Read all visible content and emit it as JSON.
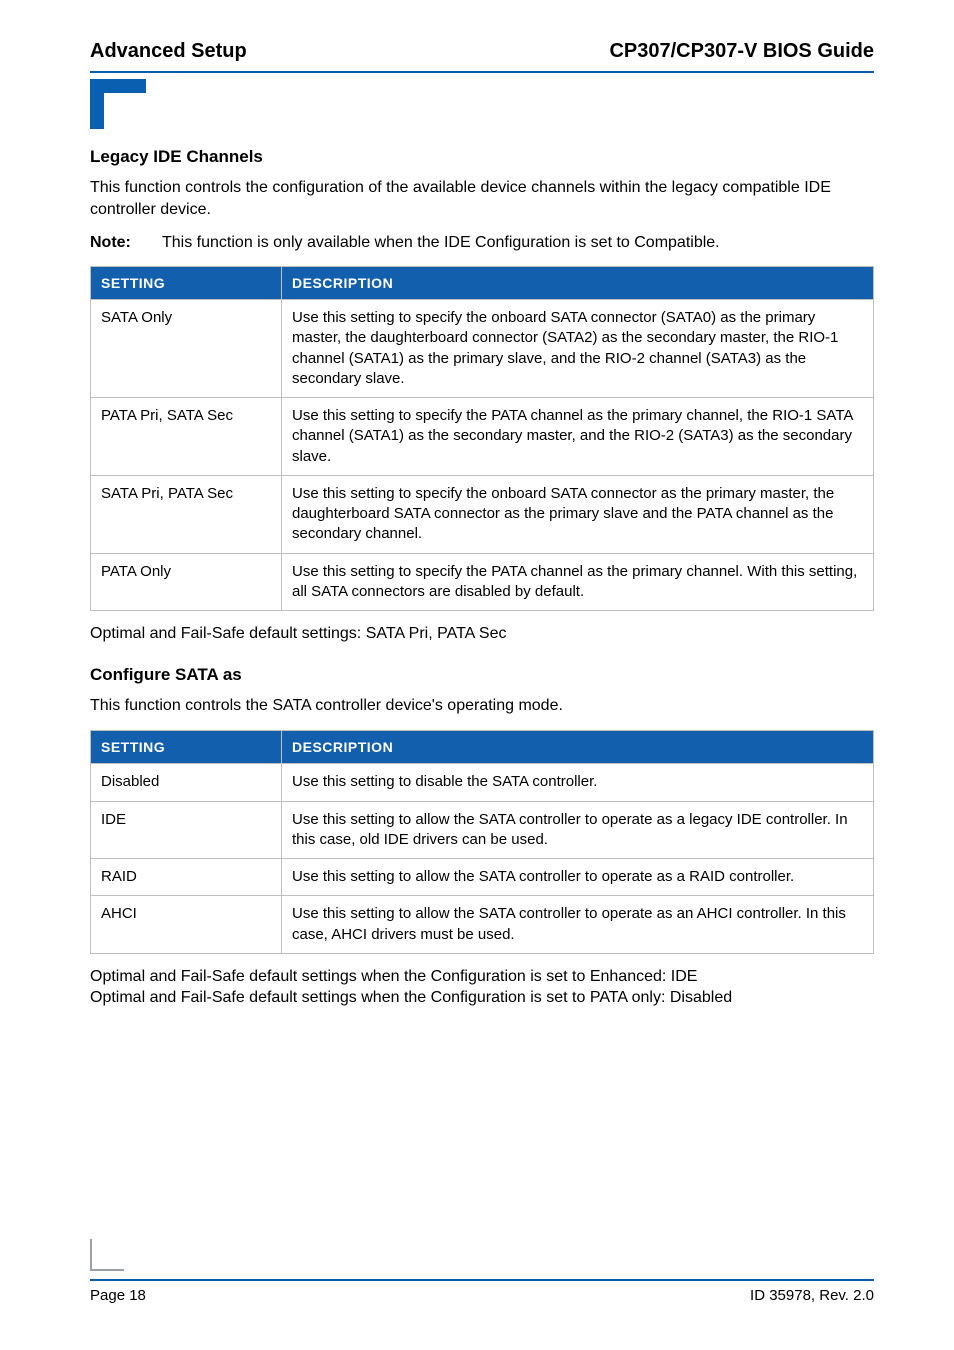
{
  "header": {
    "left": "Advanced Setup",
    "right": "CP307/CP307-V BIOS Guide"
  },
  "section1": {
    "title": "Legacy IDE Channels",
    "intro": "This function controls the configuration of the available device channels within the legacy compatible IDE controller device.",
    "note_label": "Note:",
    "note_text": "This function is only available when the IDE Configuration is set to Compatible.",
    "col_setting": "SETTING",
    "col_desc": "DESCRIPTION",
    "rows": [
      {
        "setting": "SATA Only",
        "desc": "Use this setting to specify the onboard SATA connector (SATA0) as the primary master, the daughterboard connector (SATA2) as the secondary master, the RIO-1 channel (SATA1) as the primary slave, and the RIO-2 channel (SATA3) as the secondary slave."
      },
      {
        "setting": "PATA Pri, SATA Sec",
        "desc": "Use this setting to specify the PATA channel as the primary channel, the RIO-1 SATA channel (SATA1) as the secondary master, and the RIO-2 (SATA3) as the secondary slave."
      },
      {
        "setting": "SATA Pri, PATA Sec",
        "desc": "Use this setting to specify the onboard SATA connector as the primary master, the daughterboard SATA connector as the primary slave and the PATA channel as the secondary channel."
      },
      {
        "setting": "PATA Only",
        "desc": "Use this setting to specify the PATA channel as the primary channel. With this setting, all SATA connectors are disabled by default."
      }
    ],
    "after": "Optimal and Fail-Safe default settings: SATA Pri, PATA Sec"
  },
  "section2": {
    "title": "Configure SATA as",
    "intro": "This function controls the SATA controller device's operating mode.",
    "col_setting": "SETTING",
    "col_desc": "DESCRIPTION",
    "rows": [
      {
        "setting": "Disabled",
        "desc": "Use this setting to disable the SATA controller."
      },
      {
        "setting": "IDE",
        "desc": "Use this setting to allow the SATA controller to operate as a legacy IDE controller. In this case, old IDE drivers can be used."
      },
      {
        "setting": "RAID",
        "desc": "Use this setting to allow the SATA controller to operate as a RAID controller."
      },
      {
        "setting": "AHCI",
        "desc": "Use this setting to allow the SATA controller to operate as an AHCI controller. In this case, AHCI drivers must be used."
      }
    ],
    "after1": "Optimal and Fail-Safe default settings when the Configuration is set to Enhanced: IDE",
    "after2": "Optimal and Fail-Safe default settings when the Configuration is set to PATA only: Disabled"
  },
  "footer": {
    "left": "Page 18",
    "right": "ID 35978, Rev. 2.0"
  }
}
